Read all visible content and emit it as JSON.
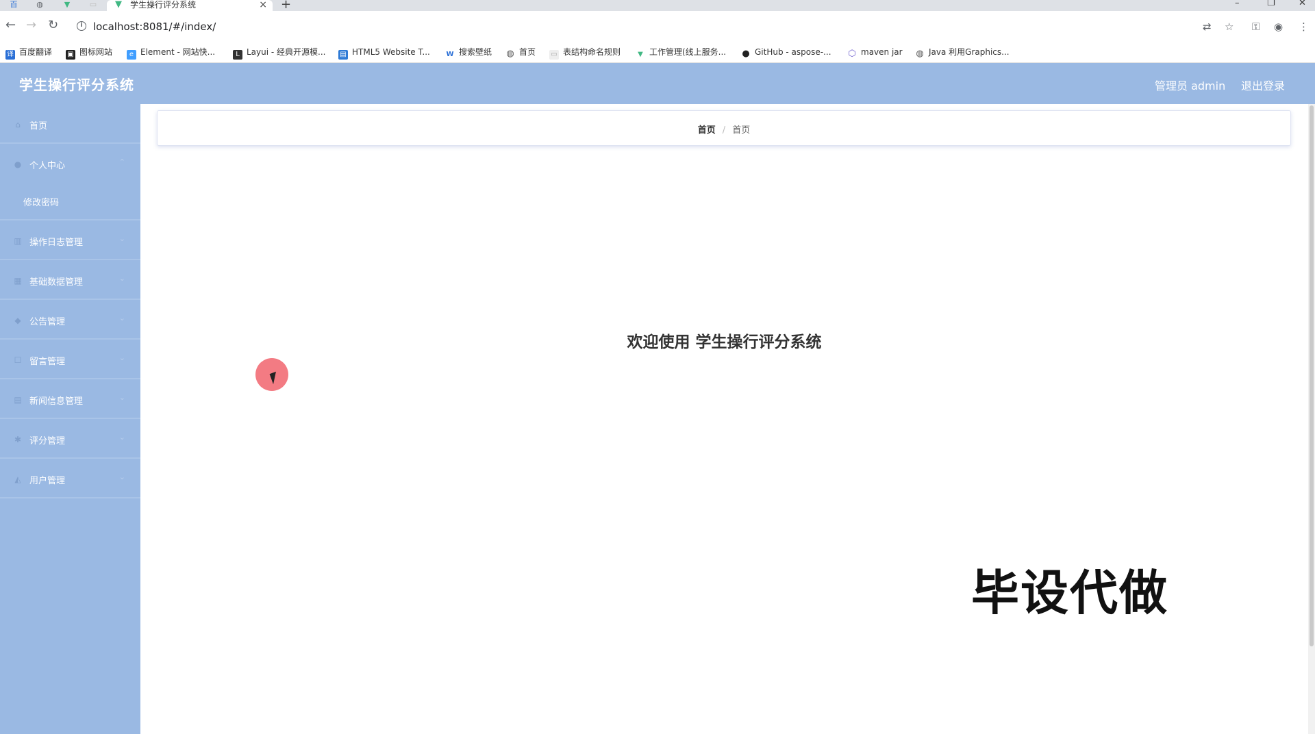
{
  "browser": {
    "tab_title": "学生操行评分系统",
    "new_tab": "+",
    "url": "localhost:8081/#/index/",
    "bookmarks": [
      "百度翻译",
      "图标网站",
      "Element - 网站快...",
      "Layui - 经典开源模...",
      "HTML5 Website T...",
      "搜索壁纸",
      "首页",
      "表结构命名规则",
      "工作管理(线上服务...",
      "GitHub - aspose-...",
      "maven jar",
      "Java 利用Graphics..."
    ]
  },
  "header": {
    "title": "学生操行评分系统",
    "user": "管理员 admin",
    "logout": "退出登录"
  },
  "sidebar": {
    "items": [
      {
        "label": "首页",
        "icon": "home-icon"
      },
      {
        "label": "个人中心",
        "icon": "user-icon"
      },
      {
        "label": "修改密码",
        "sub": true
      },
      {
        "label": "操作日志管理",
        "icon": "chart-icon"
      },
      {
        "label": "基础数据管理",
        "icon": "data-icon"
      },
      {
        "label": "公告管理",
        "icon": "notice-icon"
      },
      {
        "label": "留言管理",
        "icon": "message-icon"
      },
      {
        "label": "新闻信息管理",
        "icon": "news-icon"
      },
      {
        "label": "评分管理",
        "icon": "score-icon"
      },
      {
        "label": "用户管理",
        "icon": "users-icon"
      }
    ]
  },
  "breadcrumb": {
    "first": "首页",
    "separator": "/",
    "second": "首页"
  },
  "main": {
    "welcome": "欢迎使用 学生操行评分系统"
  },
  "watermark": "毕设代做",
  "colors": {
    "theme": "#9ab9e3",
    "cursor": "#f05a64"
  }
}
